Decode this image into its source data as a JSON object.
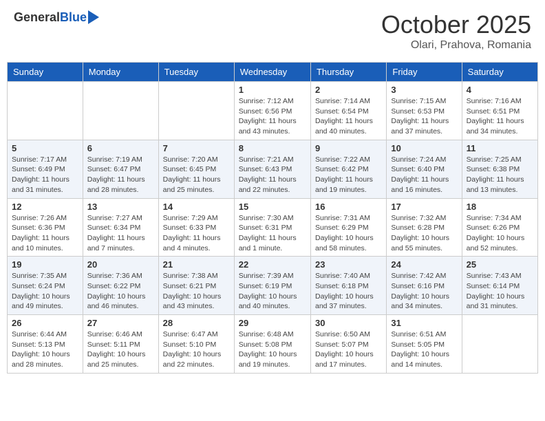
{
  "header": {
    "logo_general": "General",
    "logo_blue": "Blue",
    "month_title": "October 2025",
    "location": "Olari, Prahova, Romania"
  },
  "days_of_week": [
    "Sunday",
    "Monday",
    "Tuesday",
    "Wednesday",
    "Thursday",
    "Friday",
    "Saturday"
  ],
  "weeks": [
    [
      {
        "day": "",
        "info": ""
      },
      {
        "day": "",
        "info": ""
      },
      {
        "day": "",
        "info": ""
      },
      {
        "day": "1",
        "info": "Sunrise: 7:12 AM\nSunset: 6:56 PM\nDaylight: 11 hours and 43 minutes."
      },
      {
        "day": "2",
        "info": "Sunrise: 7:14 AM\nSunset: 6:54 PM\nDaylight: 11 hours and 40 minutes."
      },
      {
        "day": "3",
        "info": "Sunrise: 7:15 AM\nSunset: 6:53 PM\nDaylight: 11 hours and 37 minutes."
      },
      {
        "day": "4",
        "info": "Sunrise: 7:16 AM\nSunset: 6:51 PM\nDaylight: 11 hours and 34 minutes."
      }
    ],
    [
      {
        "day": "5",
        "info": "Sunrise: 7:17 AM\nSunset: 6:49 PM\nDaylight: 11 hours and 31 minutes."
      },
      {
        "day": "6",
        "info": "Sunrise: 7:19 AM\nSunset: 6:47 PM\nDaylight: 11 hours and 28 minutes."
      },
      {
        "day": "7",
        "info": "Sunrise: 7:20 AM\nSunset: 6:45 PM\nDaylight: 11 hours and 25 minutes."
      },
      {
        "day": "8",
        "info": "Sunrise: 7:21 AM\nSunset: 6:43 PM\nDaylight: 11 hours and 22 minutes."
      },
      {
        "day": "9",
        "info": "Sunrise: 7:22 AM\nSunset: 6:42 PM\nDaylight: 11 hours and 19 minutes."
      },
      {
        "day": "10",
        "info": "Sunrise: 7:24 AM\nSunset: 6:40 PM\nDaylight: 11 hours and 16 minutes."
      },
      {
        "day": "11",
        "info": "Sunrise: 7:25 AM\nSunset: 6:38 PM\nDaylight: 11 hours and 13 minutes."
      }
    ],
    [
      {
        "day": "12",
        "info": "Sunrise: 7:26 AM\nSunset: 6:36 PM\nDaylight: 11 hours and 10 minutes."
      },
      {
        "day": "13",
        "info": "Sunrise: 7:27 AM\nSunset: 6:34 PM\nDaylight: 11 hours and 7 minutes."
      },
      {
        "day": "14",
        "info": "Sunrise: 7:29 AM\nSunset: 6:33 PM\nDaylight: 11 hours and 4 minutes."
      },
      {
        "day": "15",
        "info": "Sunrise: 7:30 AM\nSunset: 6:31 PM\nDaylight: 11 hours and 1 minute."
      },
      {
        "day": "16",
        "info": "Sunrise: 7:31 AM\nSunset: 6:29 PM\nDaylight: 10 hours and 58 minutes."
      },
      {
        "day": "17",
        "info": "Sunrise: 7:32 AM\nSunset: 6:28 PM\nDaylight: 10 hours and 55 minutes."
      },
      {
        "day": "18",
        "info": "Sunrise: 7:34 AM\nSunset: 6:26 PM\nDaylight: 10 hours and 52 minutes."
      }
    ],
    [
      {
        "day": "19",
        "info": "Sunrise: 7:35 AM\nSunset: 6:24 PM\nDaylight: 10 hours and 49 minutes."
      },
      {
        "day": "20",
        "info": "Sunrise: 7:36 AM\nSunset: 6:22 PM\nDaylight: 10 hours and 46 minutes."
      },
      {
        "day": "21",
        "info": "Sunrise: 7:38 AM\nSunset: 6:21 PM\nDaylight: 10 hours and 43 minutes."
      },
      {
        "day": "22",
        "info": "Sunrise: 7:39 AM\nSunset: 6:19 PM\nDaylight: 10 hours and 40 minutes."
      },
      {
        "day": "23",
        "info": "Sunrise: 7:40 AM\nSunset: 6:18 PM\nDaylight: 10 hours and 37 minutes."
      },
      {
        "day": "24",
        "info": "Sunrise: 7:42 AM\nSunset: 6:16 PM\nDaylight: 10 hours and 34 minutes."
      },
      {
        "day": "25",
        "info": "Sunrise: 7:43 AM\nSunset: 6:14 PM\nDaylight: 10 hours and 31 minutes."
      }
    ],
    [
      {
        "day": "26",
        "info": "Sunrise: 6:44 AM\nSunset: 5:13 PM\nDaylight: 10 hours and 28 minutes."
      },
      {
        "day": "27",
        "info": "Sunrise: 6:46 AM\nSunset: 5:11 PM\nDaylight: 10 hours and 25 minutes."
      },
      {
        "day": "28",
        "info": "Sunrise: 6:47 AM\nSunset: 5:10 PM\nDaylight: 10 hours and 22 minutes."
      },
      {
        "day": "29",
        "info": "Sunrise: 6:48 AM\nSunset: 5:08 PM\nDaylight: 10 hours and 19 minutes."
      },
      {
        "day": "30",
        "info": "Sunrise: 6:50 AM\nSunset: 5:07 PM\nDaylight: 10 hours and 17 minutes."
      },
      {
        "day": "31",
        "info": "Sunrise: 6:51 AM\nSunset: 5:05 PM\nDaylight: 10 hours and 14 minutes."
      },
      {
        "day": "",
        "info": ""
      }
    ]
  ]
}
